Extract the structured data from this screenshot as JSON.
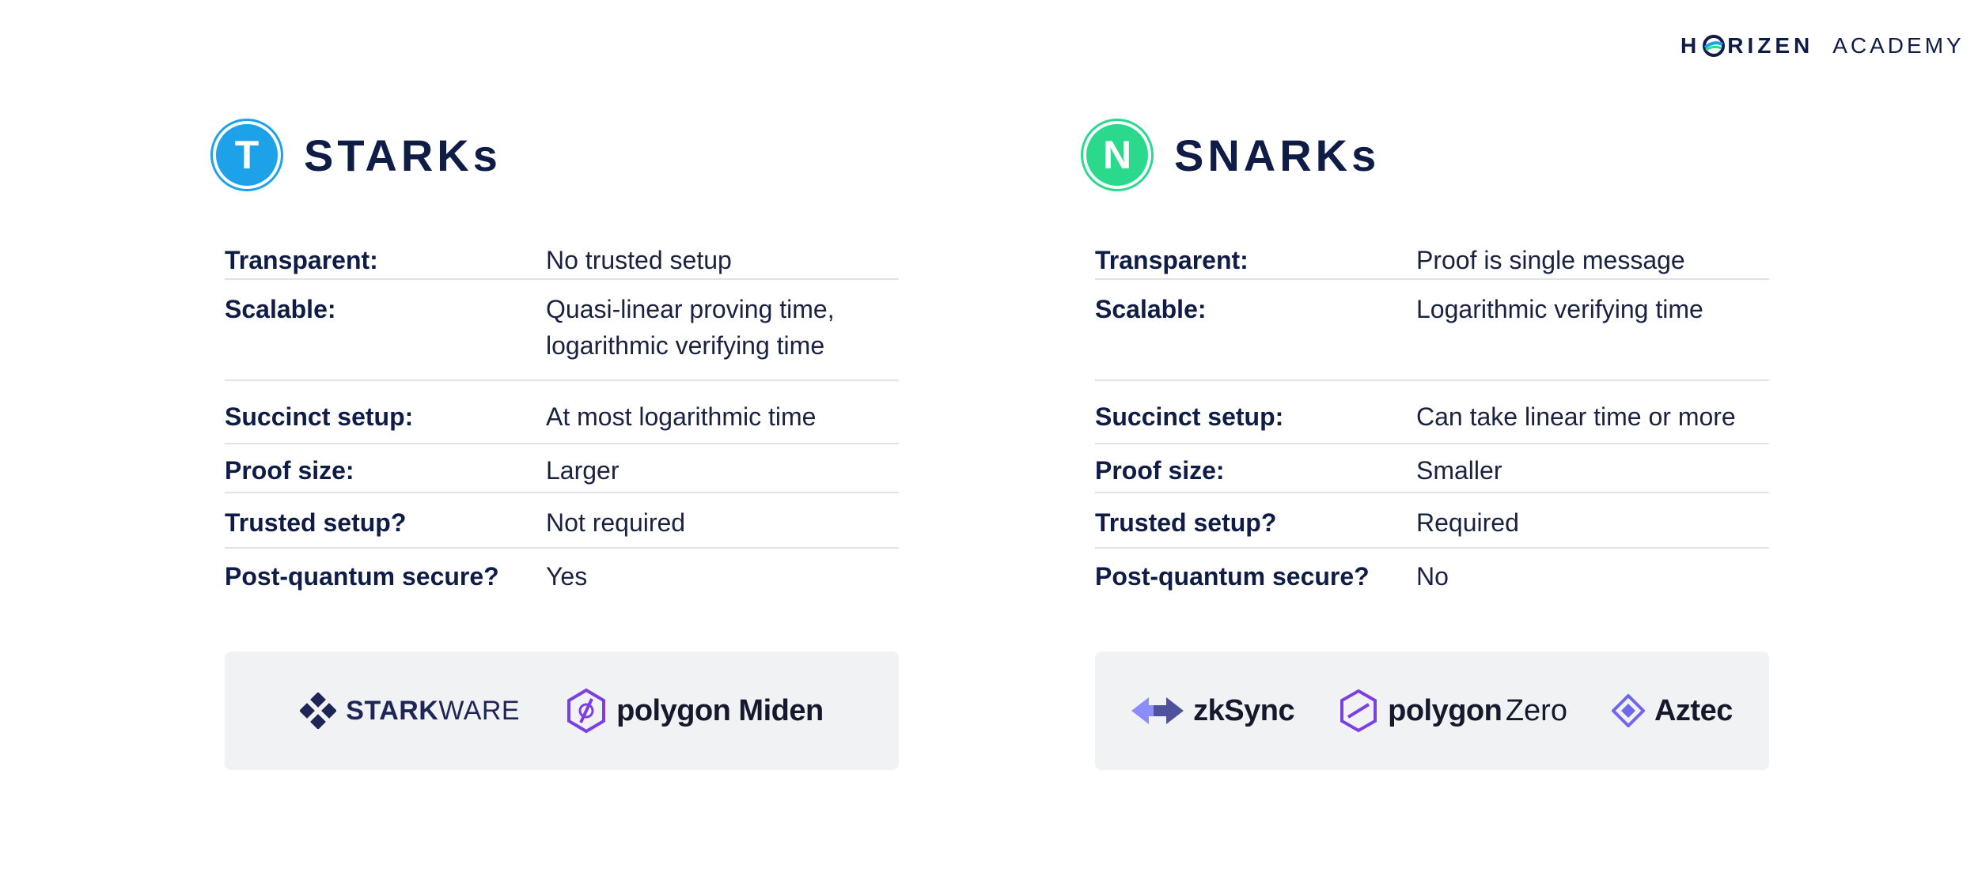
{
  "brand": {
    "left_letters": "H",
    "right_letters": "RIZEN",
    "academy": "ACADEMY",
    "icon": "horizen-o-icon"
  },
  "columns": [
    {
      "badge_letter": "T",
      "badge_color": "#1da1e8",
      "title": "STARKs",
      "rows": [
        {
          "label": "Transparent:",
          "value": "No trusted setup"
        },
        {
          "label": "Scalable:",
          "value": "Quasi-linear proving time, logarithmic verifying time",
          "value_line1": "Quasi-linear proving time,",
          "value_line2": "logarithmic verifying time"
        },
        {
          "label": "Succinct setup:",
          "value": "At most logarithmic time"
        },
        {
          "label": "Proof size:",
          "value": "Larger"
        },
        {
          "label": "Trusted setup?",
          "value": "Not required"
        },
        {
          "label": "Post-quantum secure?",
          "value": "Yes"
        }
      ],
      "logos": [
        {
          "icon": "starkware-icon",
          "bold": "STARK",
          "regular": "WARE"
        },
        {
          "icon": "polygon-icon",
          "bold": "polygon Miden"
        }
      ]
    },
    {
      "badge_letter": "N",
      "badge_color": "#2bd98c",
      "title": "SNARKs",
      "rows": [
        {
          "label": "Transparent:",
          "value": "Proof is single message"
        },
        {
          "label": "Scalable:",
          "value": "Logarithmic verifying time"
        },
        {
          "label": "Succinct setup:",
          "value": "Can take linear time or more"
        },
        {
          "label": "Proof size:",
          "value": "Smaller"
        },
        {
          "label": "Trusted setup?",
          "value": "Required"
        },
        {
          "label": "Post-quantum secure?",
          "value": "No"
        }
      ],
      "logos": [
        {
          "icon": "zksync-icon",
          "bold": "zkSync"
        },
        {
          "icon": "polygon-icon",
          "bold": "polygon",
          "regular": "Zero"
        },
        {
          "icon": "aztec-icon",
          "bold": "Aztec"
        }
      ]
    }
  ]
}
